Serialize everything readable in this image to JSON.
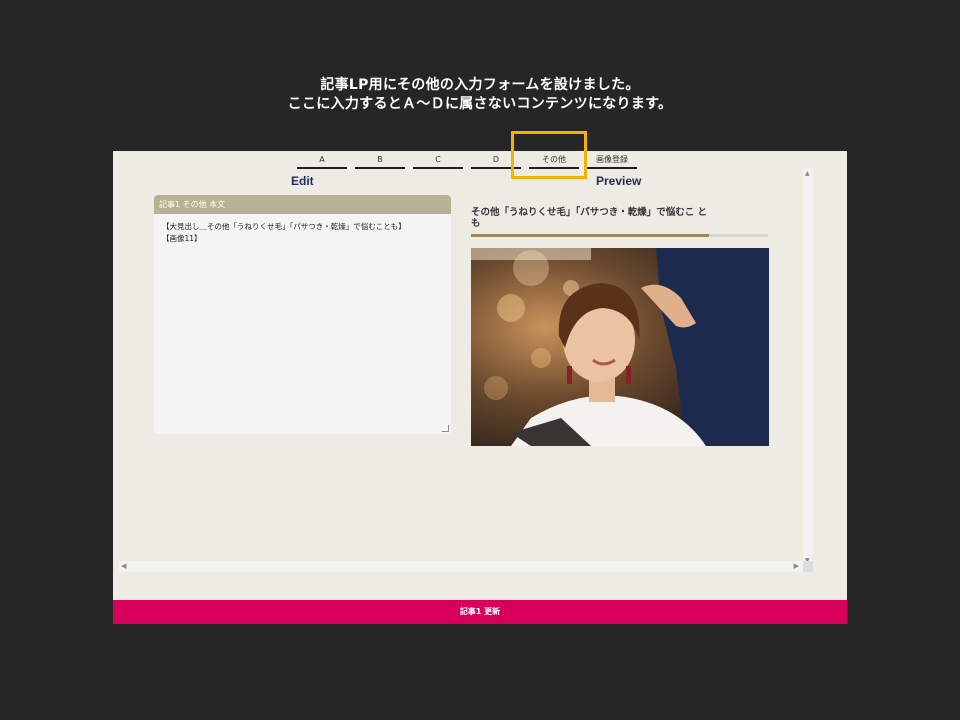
{
  "caption": {
    "line1": "記事LP用にその他の入力フォームを設けました。",
    "line2": "ここに入力するとＡ～Ｄに属さないコンテンツになります。"
  },
  "tabs": [
    "A",
    "B",
    "C",
    "D",
    "その他",
    "画像登録"
  ],
  "active_tab": "その他",
  "edit": {
    "title": "Edit",
    "panel_header": "記事1 その他 本文",
    "lines": [
      "【大見出し＿その他「うねりくせ毛」「パサつき・乾燥」で悩むことも】",
      "【画像11】"
    ]
  },
  "preview": {
    "title": "Preview",
    "heading": "その他「うねりくせ毛」「パサつき・乾燥」で悩むこ とも",
    "rule_fill_fraction": 0.8
  },
  "footer": {
    "update_label": "記事1 更新"
  },
  "colors": {
    "accent": "#d9005c",
    "highlight": "#f2b400",
    "panel_header": "#b8b294",
    "title": "#1f2a55"
  }
}
